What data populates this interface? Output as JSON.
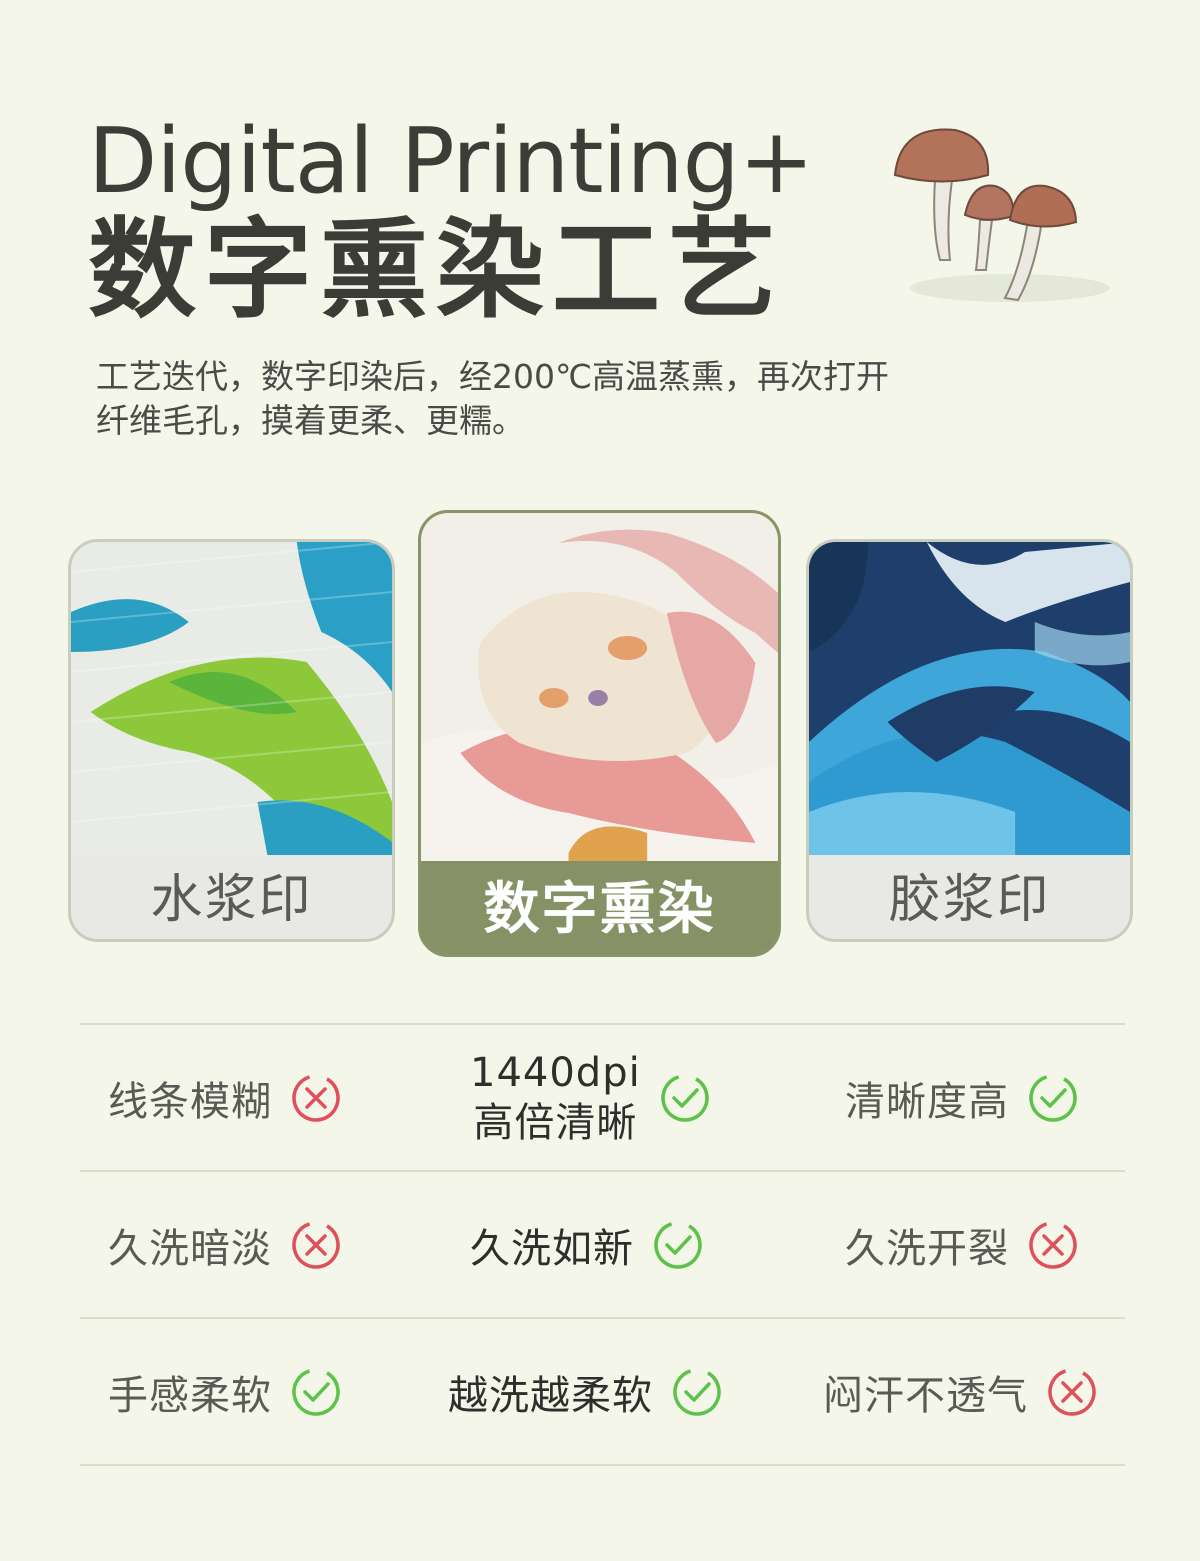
{
  "header": {
    "title_en": "Digital Printing+",
    "title_cn": "数字熏染工艺",
    "description_line1": "工艺迭代，数字印染后，经200℃高温蒸熏，再次打开",
    "description_line2": "纤维毛孔，摸着更柔、更糯。"
  },
  "cards": [
    {
      "label": "水浆印"
    },
    {
      "label": "数字熏染"
    },
    {
      "label": "胶浆印"
    }
  ],
  "comparison": {
    "rows": [
      {
        "left": {
          "text": "线条模糊",
          "icon": "cross-circle-icon"
        },
        "mid": {
          "line1": "1440dpi",
          "line2": "高倍清晰",
          "icon": "check-circle-icon"
        },
        "right": {
          "text": "清晰度高",
          "icon": "check-circle-icon"
        }
      },
      {
        "left": {
          "text": "久洗暗淡",
          "icon": "cross-circle-icon"
        },
        "mid": {
          "text": "久洗如新",
          "icon": "check-circle-icon"
        },
        "right": {
          "text": "久洗开裂",
          "icon": "cross-circle-icon"
        }
      },
      {
        "left": {
          "text": "手感柔软",
          "icon": "check-circle-icon"
        },
        "mid": {
          "text": "越洗越柔软",
          "icon": "check-circle-icon"
        },
        "right": {
          "text": "闷汗不透气",
          "icon": "cross-circle-icon"
        }
      }
    ]
  },
  "colors": {
    "background": "#f3f6e9",
    "accent_green": "#869165",
    "check_green": "#5cc24a",
    "cross_red": "#e0505a"
  }
}
